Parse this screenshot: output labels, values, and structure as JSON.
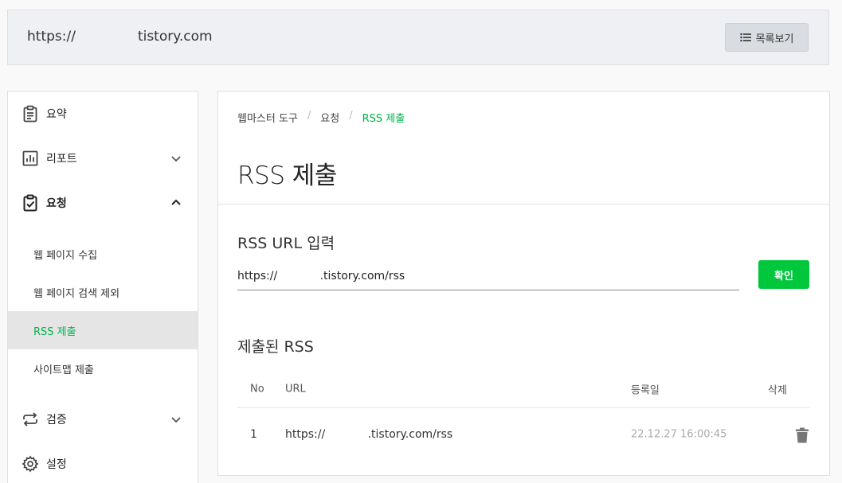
{
  "site": {
    "url_prefix": "https://",
    "url_suffix": "tistory.com"
  },
  "header": {
    "list_button_label": "목록보기"
  },
  "sidebar": {
    "items": [
      {
        "label": "요약",
        "icon": "clipboard-icon"
      },
      {
        "label": "리포트",
        "icon": "chart-icon",
        "expanded": false
      },
      {
        "label": "요청",
        "icon": "clipboard-check-icon",
        "expanded": true
      },
      {
        "label": "검증",
        "icon": "repeat-icon",
        "expanded": false
      },
      {
        "label": "설정",
        "icon": "gear-icon"
      }
    ],
    "request_sub_items": [
      {
        "label": "웹 페이지 수집",
        "active": false
      },
      {
        "label": "웹 페이지 검색 제외",
        "active": false
      },
      {
        "label": "RSS 제출",
        "active": true
      },
      {
        "label": "사이트맵 제출",
        "active": false
      }
    ]
  },
  "breadcrumb": {
    "items": [
      "웹마스터 도구",
      "요청",
      "RSS 제출"
    ],
    "separator": "/"
  },
  "page": {
    "title": "RSS 제출"
  },
  "rss_form": {
    "label": "RSS URL 입력",
    "value": "https://            .tistory.com/rss",
    "submit_label": "확인"
  },
  "submitted": {
    "label": "제출된 RSS",
    "columns": [
      "No",
      "URL",
      "등록일",
      "삭제"
    ],
    "rows": [
      {
        "no": "1",
        "url": "https://            .tistory.com/rss",
        "date": "22.12.27 16:00:45"
      }
    ]
  },
  "colors": {
    "accent": "#00c73c",
    "active_text": "#00b34a"
  }
}
